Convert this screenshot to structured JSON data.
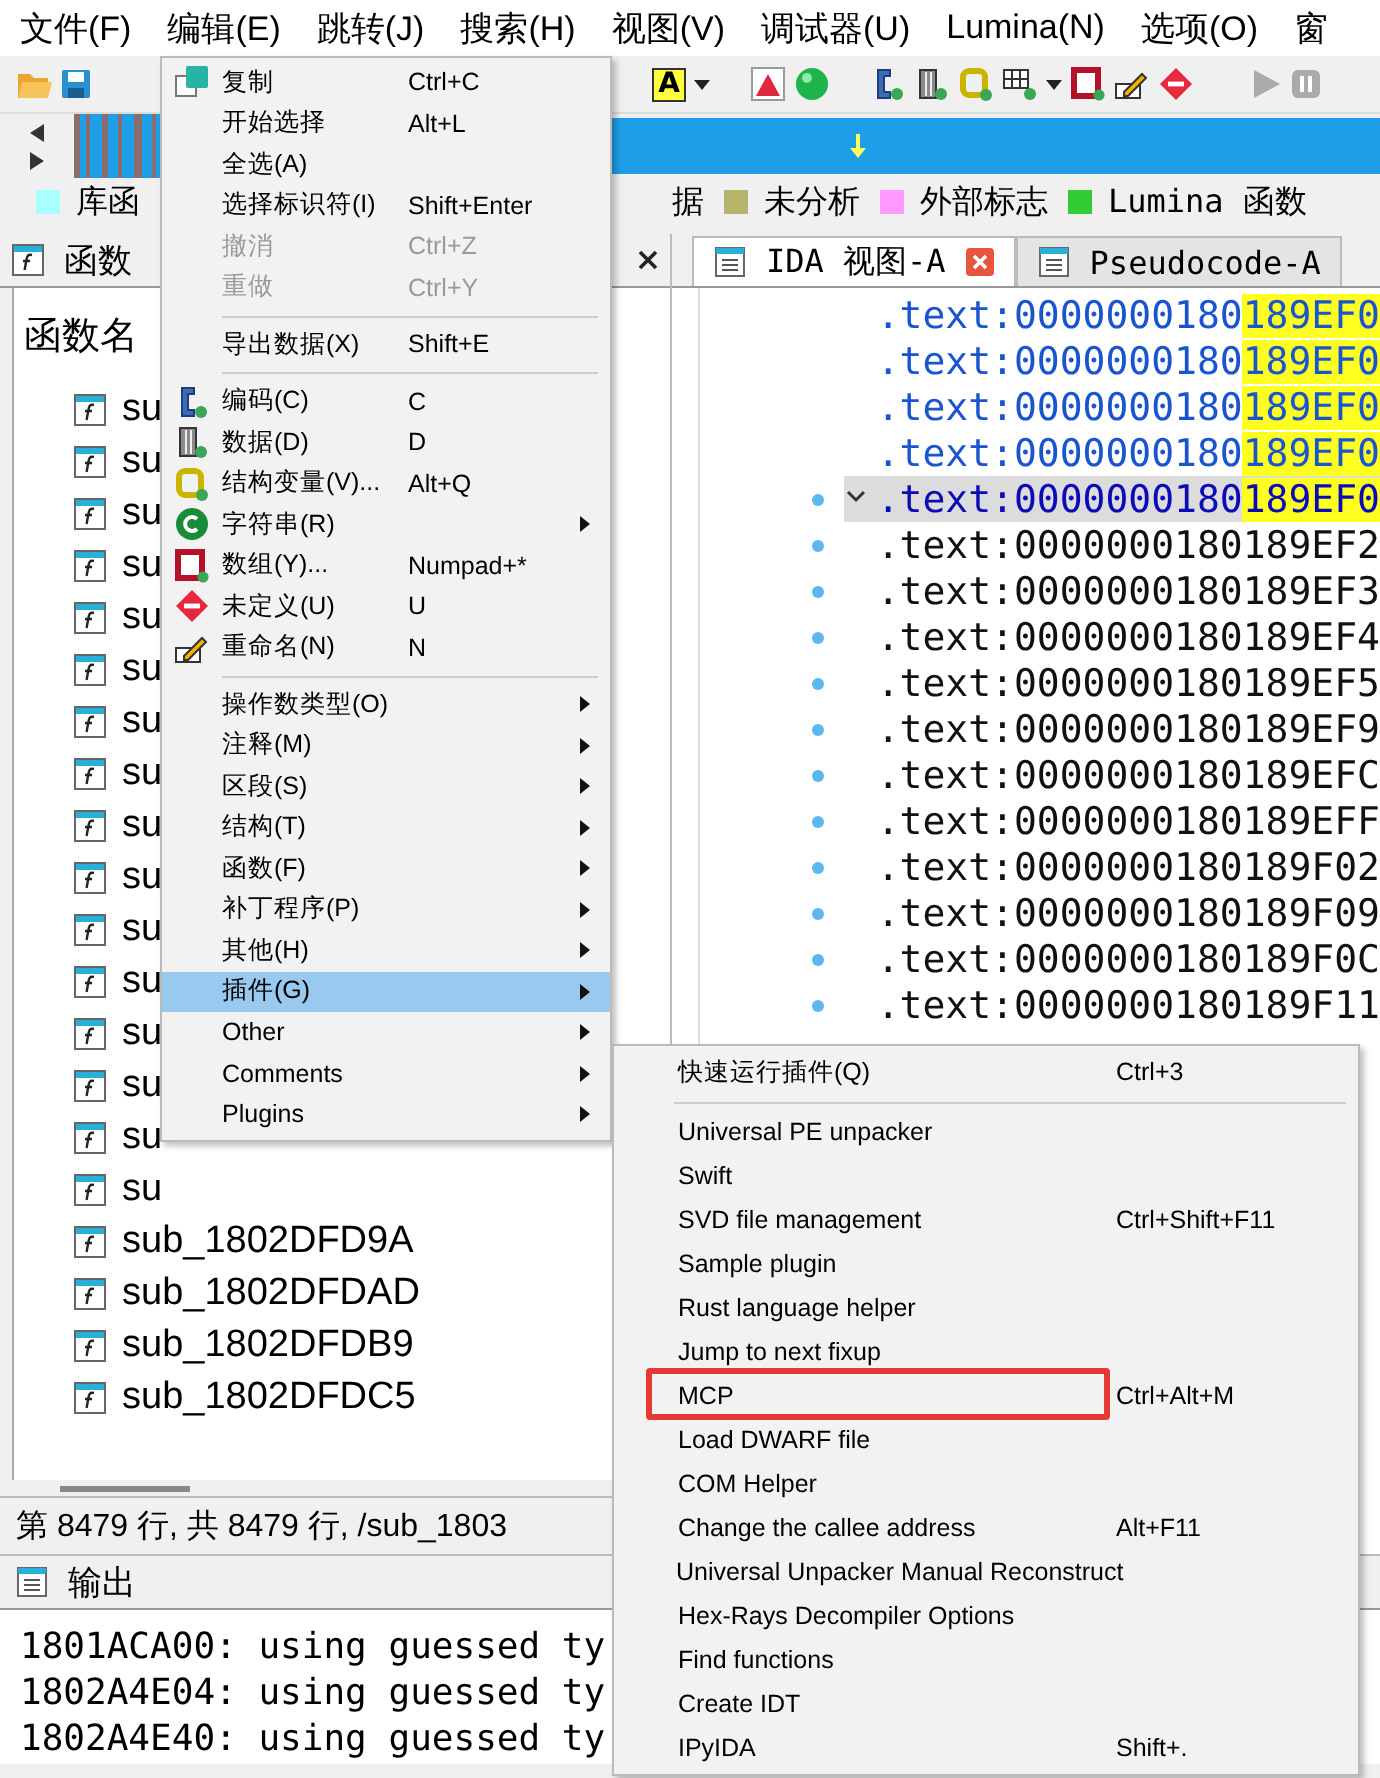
{
  "menubar": [
    {
      "label": "文件(F)"
    },
    {
      "label": "编辑(E)"
    },
    {
      "label": "跳转(J)"
    },
    {
      "label": "搜索(H)"
    },
    {
      "label": "视图(V)"
    },
    {
      "label": "调试器(U)"
    },
    {
      "label": "Lumina(N)"
    },
    {
      "label": "选项(O)"
    },
    {
      "label": "窗"
    }
  ],
  "toolbar": {
    "text_button": "A"
  },
  "legend": [
    {
      "label": "库函",
      "color": "#aaffff"
    },
    {
      "label": "据"
    },
    {
      "label": "未分析",
      "color": "#b5b56b"
    },
    {
      "label": "外部标志",
      "color": "#ff99ff"
    },
    {
      "label": "Lumina 函数",
      "color": "#33cc33"
    }
  ],
  "functions_panel": {
    "title": "函数",
    "column": "函数名",
    "rows": [
      "su",
      "su",
      "su",
      "su",
      "su",
      "su",
      "su",
      "su",
      "su",
      "su",
      "su",
      "su",
      "su",
      "su",
      "su",
      "su",
      "sub_1802DFD9A",
      "sub_1802DFDAD",
      "sub_1802DFDB9",
      "sub_1802DFDC5"
    ],
    "status": "第 8479 行, 共 8479 行, /sub_1803"
  },
  "tabs": [
    {
      "label": "IDA 视图-A",
      "selected": true
    },
    {
      "label": "Pseudocode-A",
      "selected": false
    }
  ],
  "disassembly": [
    {
      "text": ".text:0000000180",
      "highlight": "189EF0",
      "kind": "name",
      "selected": false,
      "dot": false
    },
    {
      "text": ".text:0000000180",
      "highlight": "189EF0",
      "kind": "name",
      "selected": false,
      "dot": false
    },
    {
      "text": ".text:0000000180",
      "highlight": "189EF0",
      "kind": "name",
      "selected": false,
      "dot": false
    },
    {
      "text": ".text:0000000180",
      "highlight": "189EF0",
      "kind": "name",
      "selected": false,
      "dot": false
    },
    {
      "text": ".text:0000000180",
      "highlight": "189EF0",
      "kind": "name",
      "selected": true,
      "dot": true
    },
    {
      "text": ".text:0000000180189EF2",
      "kind": "plain",
      "selected": false,
      "dot": true
    },
    {
      "text": ".text:0000000180189EF3",
      "kind": "plain",
      "selected": false,
      "dot": true
    },
    {
      "text": ".text:0000000180189EF4",
      "kind": "plain",
      "selected": false,
      "dot": true
    },
    {
      "text": ".text:0000000180189EF5",
      "kind": "plain",
      "selected": false,
      "dot": true
    },
    {
      "text": ".text:0000000180189EF9",
      "kind": "plain",
      "selected": false,
      "dot": true
    },
    {
      "text": ".text:0000000180189EFC",
      "kind": "plain",
      "selected": false,
      "dot": true
    },
    {
      "text": ".text:0000000180189EFF",
      "kind": "plain",
      "selected": false,
      "dot": true
    },
    {
      "text": ".text:0000000180189F02",
      "kind": "plain",
      "selected": false,
      "dot": true
    },
    {
      "text": ".text:0000000180189F09",
      "kind": "plain",
      "selected": false,
      "dot": true
    },
    {
      "text": ".text:0000000180189F0C",
      "kind": "plain",
      "selected": false,
      "dot": true
    },
    {
      "text": ".text:0000000180189F11",
      "kind": "plain",
      "selected": false,
      "dot": true
    }
  ],
  "output": {
    "title": "输出",
    "lines": [
      "1801ACA00: using guessed ty",
      "1802A4E04: using guessed ty",
      "1802A4E40: using guessed ty"
    ]
  },
  "edit_menu": [
    {
      "kind": "item",
      "label": "复制",
      "shortcut": "Ctrl+C",
      "icon": true,
      "disabled": false,
      "selected": false
    },
    {
      "kind": "item",
      "label": "开始选择",
      "shortcut": "Alt+L",
      "disabled": false,
      "selected": false
    },
    {
      "kind": "item",
      "label": "全选(A)",
      "disabled": false,
      "selected": false
    },
    {
      "kind": "item",
      "label": "选择标识符(I)",
      "shortcut": "Shift+Enter",
      "disabled": false,
      "selected": false
    },
    {
      "kind": "item",
      "label": "撤消",
      "shortcut": "Ctrl+Z",
      "disabled": true,
      "selected": false
    },
    {
      "kind": "item",
      "label": "重做",
      "shortcut": "Ctrl+Y",
      "disabled": true,
      "selected": false
    },
    {
      "kind": "separator"
    },
    {
      "kind": "item",
      "label": "导出数据(X)",
      "shortcut": "Shift+E",
      "disabled": false,
      "selected": false
    },
    {
      "kind": "separator"
    },
    {
      "kind": "item",
      "label": "编码(C)",
      "shortcut": "C",
      "icon": true,
      "disabled": false,
      "selected": false
    },
    {
      "kind": "item",
      "label": "数据(D)",
      "shortcut": "D",
      "icon": true,
      "disabled": false,
      "selected": false
    },
    {
      "kind": "item",
      "label": "结构变量(V)...",
      "shortcut": "Alt+Q",
      "icon": true,
      "disabled": false,
      "selected": false
    },
    {
      "kind": "item",
      "label": "字符串(R)",
      "icon": true,
      "submenu": true,
      "disabled": false,
      "selected": false
    },
    {
      "kind": "item",
      "label": "数组(Y)...",
      "shortcut": "Numpad+*",
      "icon": true,
      "disabled": false,
      "selected": false
    },
    {
      "kind": "item",
      "label": "未定义(U)",
      "shortcut": "U",
      "icon": true,
      "disabled": false,
      "selected": false
    },
    {
      "kind": "item",
      "label": "重命名(N)",
      "shortcut": "N",
      "icon": true,
      "disabled": false,
      "selected": false
    },
    {
      "kind": "separator"
    },
    {
      "kind": "item",
      "label": "操作数类型(O)",
      "submenu": true,
      "disabled": false,
      "selected": false
    },
    {
      "kind": "item",
      "label": "注释(M)",
      "submenu": true,
      "disabled": false,
      "selected": false
    },
    {
      "kind": "item",
      "label": "区段(S)",
      "submenu": true,
      "disabled": false,
      "selected": false
    },
    {
      "kind": "item",
      "label": "结构(T)",
      "submenu": true,
      "disabled": false,
      "selected": false
    },
    {
      "kind": "item",
      "label": "函数(F)",
      "submenu": true,
      "disabled": false,
      "selected": false
    },
    {
      "kind": "item",
      "label": "补丁程序(P)",
      "submenu": true,
      "disabled": false,
      "selected": false
    },
    {
      "kind": "item",
      "label": "其他(H)",
      "submenu": true,
      "disabled": false,
      "selected": false
    },
    {
      "kind": "item",
      "label": "插件(G)",
      "submenu": true,
      "disabled": false,
      "selected": true
    },
    {
      "kind": "item",
      "label": "Other",
      "submenu": true,
      "disabled": false,
      "selected": false
    },
    {
      "kind": "item",
      "label": "Comments",
      "submenu": true,
      "disabled": false,
      "selected": false
    },
    {
      "kind": "item",
      "label": "Plugins",
      "submenu": true,
      "disabled": false,
      "selected": false
    }
  ],
  "plugins_submenu": [
    {
      "kind": "item",
      "label": "快速运行插件(Q)",
      "shortcut": "Ctrl+3",
      "highlighted": false
    },
    {
      "kind": "separator"
    },
    {
      "kind": "item",
      "label": "Universal PE unpacker",
      "highlighted": false
    },
    {
      "kind": "item",
      "label": "Swift",
      "highlighted": false
    },
    {
      "kind": "item",
      "label": "SVD file management",
      "shortcut": "Ctrl+Shift+F11",
      "highlighted": false
    },
    {
      "kind": "item",
      "label": "Sample plugin",
      "highlighted": false
    },
    {
      "kind": "item",
      "label": "Rust language helper",
      "highlighted": false
    },
    {
      "kind": "item",
      "label": "Jump to next fixup",
      "highlighted": false
    },
    {
      "kind": "item",
      "label": "MCP",
      "shortcut": "Ctrl+Alt+M",
      "highlighted": true
    },
    {
      "kind": "item",
      "label": "Load DWARF file",
      "highlighted": false
    },
    {
      "kind": "item",
      "label": "COM Helper",
      "highlighted": false
    },
    {
      "kind": "item",
      "label": "Change the callee address",
      "shortcut": "Alt+F11",
      "highlighted": false
    },
    {
      "kind": "item",
      "label": "Universal Unpacker Manual Reconstruct",
      "highlighted": false
    },
    {
      "kind": "item",
      "label": "Hex-Rays Decompiler Options",
      "highlighted": false
    },
    {
      "kind": "item",
      "label": "Find functions",
      "highlighted": false
    },
    {
      "kind": "item",
      "label": "Create IDT",
      "highlighted": false
    },
    {
      "kind": "item",
      "label": "IPyIDA",
      "shortcut": "Shift+.",
      "highlighted": false
    }
  ]
}
